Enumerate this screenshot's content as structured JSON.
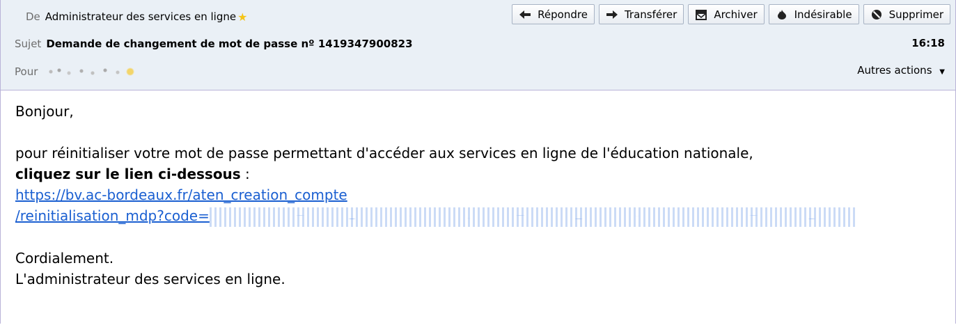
{
  "header": {
    "from_label": "De",
    "from_value": "Administrateur des services en ligne",
    "subject_label": "Sujet",
    "subject_value": "Demande de changement de mot de passe nº 1419347900823",
    "to_label": "Pour",
    "time": "16:18",
    "more_actions": "Autres actions"
  },
  "toolbar": {
    "reply": "Répondre",
    "forward": "Transférer",
    "archive": "Archiver",
    "junk": "Indésirable",
    "delete": "Supprimer"
  },
  "icons": [
    "star-icon",
    "reply-icon",
    "forward-icon",
    "archive-icon",
    "flame-icon",
    "no-entry-icon",
    "dropdown-arrow-icon"
  ],
  "message": {
    "greeting": "Bonjour,",
    "line1": "pour réinitialiser votre mot de passe permettant d'accéder aux services en ligne de l'éducation nationale,",
    "cta_bold": "cliquez sur le lien ci-dessous",
    "cta_suffix": " :",
    "link_line1": "https://bv.ac-bordeaux.fr/aten_creation_compte",
    "link_line2": "/reinitialisation_mdp?code=",
    "closing": "Cordialement.",
    "signature": "L'administrateur des services en ligne."
  },
  "colors": {
    "header_bg": "#eaf0f6",
    "border": "#b9b3d8",
    "link": "#1a5fd1"
  }
}
